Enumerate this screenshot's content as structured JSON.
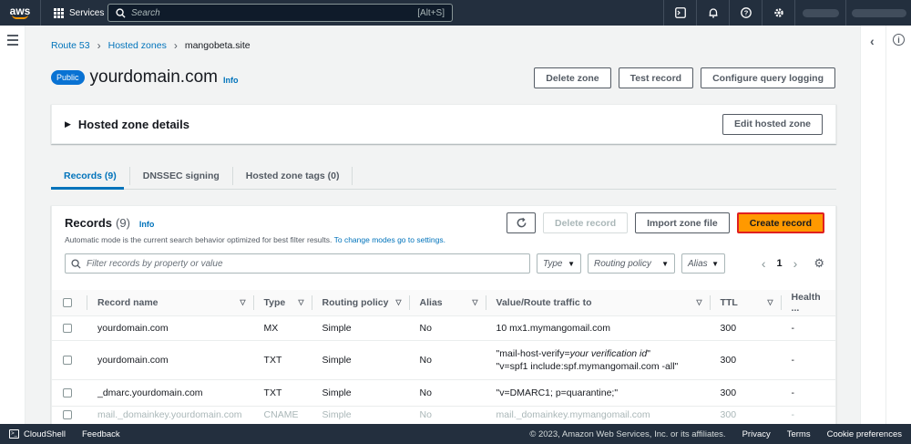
{
  "topnav": {
    "logo": "aws",
    "services_label": "Services",
    "search_placeholder": "Search",
    "search_shortcut": "[Alt+S]"
  },
  "breadcrumb": {
    "items": [
      "Route 53",
      "Hosted zones",
      "mangobeta.site"
    ]
  },
  "header": {
    "badge": "Public",
    "title": "yourdomain.com",
    "info": "Info",
    "actions": [
      "Delete zone",
      "Test record",
      "Configure query logging"
    ]
  },
  "details": {
    "title": "Hosted zone details",
    "edit_button": "Edit hosted zone"
  },
  "tabs": [
    "Records (9)",
    "DNSSEC signing",
    "Hosted zone tags (0)"
  ],
  "records": {
    "title": "Records",
    "count": "(9)",
    "info": "Info",
    "description": "Automatic mode is the current search behavior optimized for best filter results.",
    "description_link": "To change modes go to settings.",
    "refresh_icon": "refresh-icon",
    "actions": {
      "delete": "Delete record",
      "import": "Import zone file",
      "create": "Create record"
    },
    "filter_placeholder": "Filter records by property or value",
    "filters": {
      "type": "Type",
      "routing": "Routing policy",
      "alias": "Alias"
    },
    "page": "1",
    "columns": [
      "Record name",
      "Type",
      "Routing policy",
      "Alias",
      "Value/Route traffic to",
      "TTL",
      "Health ..."
    ],
    "rows": [
      {
        "name": "yourdomain.com",
        "type": "MX",
        "routing": "Simple",
        "alias": "No",
        "value1": "10 mx1.mymangomail.com",
        "ttl": "300",
        "health": "-"
      },
      {
        "name": "yourdomain.com",
        "type": "TXT",
        "routing": "Simple",
        "alias": "No",
        "value1_prefix": "\"mail-host-verify=",
        "value1_em": "your verification id",
        "value1_suffix": "\"",
        "value2": "\"v=spf1 include:spf.mymangomail.com -all\"",
        "ttl": "300",
        "health": "-"
      },
      {
        "name": "_dmarc.yourdomain.com",
        "type": "TXT",
        "routing": "Simple",
        "alias": "No",
        "value1": "\"v=DMARC1; p=quarantine;\"",
        "ttl": "300",
        "health": "-"
      },
      {
        "name": "mail._domainkey.yourdomain.com",
        "type": "CNAME",
        "routing": "Simple",
        "alias": "No",
        "value1": "mail._domainkey.mymangomail.com",
        "ttl": "300",
        "health": "-"
      }
    ]
  },
  "footer": {
    "cloudshell": "CloudShell",
    "feedback": "Feedback",
    "copyright": "© 2023, Amazon Web Services, Inc. or its affiliates.",
    "links": [
      "Privacy",
      "Terms",
      "Cookie preferences"
    ]
  },
  "colors": {
    "nav_bg": "#232f3e",
    "link": "#0073bb",
    "primary": "#ff9900",
    "highlight_border": "#e02020"
  }
}
